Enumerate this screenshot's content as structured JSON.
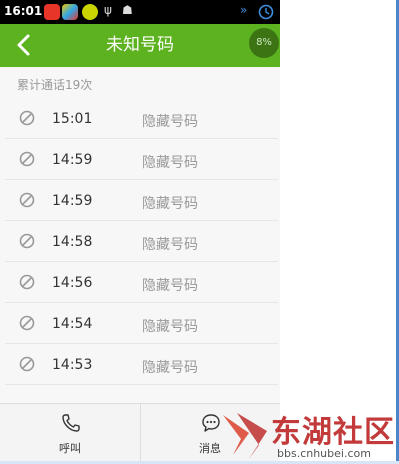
{
  "status_bar": {
    "time": "16:01",
    "icons": [
      "app-red-icon",
      "app-colorful-icon",
      "app-yellow-icon",
      "usb-icon",
      "android-icon",
      "double-arrow-icon",
      "clock-icon"
    ]
  },
  "header": {
    "title": "未知号码",
    "badge": "8%"
  },
  "summary": "累计通话19次",
  "calls": [
    {
      "time": "15:01",
      "name": "隐藏号码"
    },
    {
      "time": "14:59",
      "name": "隐藏号码"
    },
    {
      "time": "14:59",
      "name": "隐藏号码"
    },
    {
      "time": "14:58",
      "name": "隐藏号码"
    },
    {
      "time": "14:56",
      "name": "隐藏号码"
    },
    {
      "time": "14:54",
      "name": "隐藏号码"
    },
    {
      "time": "14:53",
      "name": "隐藏号码"
    }
  ],
  "bottom_nav": {
    "call_label": "呼叫",
    "message_label": "消息"
  },
  "watermark": {
    "text": "东湖社区",
    "url": "bbs.cnhubei.com"
  },
  "colors": {
    "header_green": "#5cb21f",
    "watermark_red": "#c23a3a"
  }
}
